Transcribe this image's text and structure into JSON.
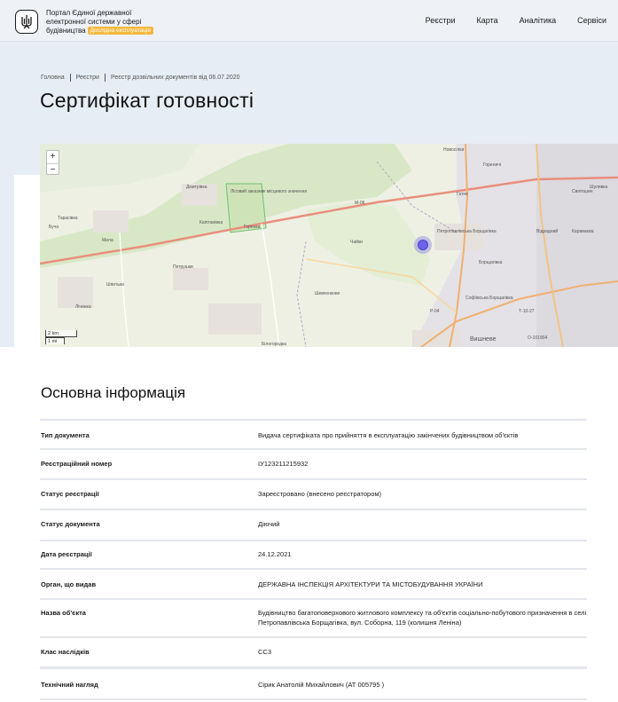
{
  "header": {
    "portal_title_lines": [
      "Портал Єдиної державної",
      "електронної системи у сфері",
      "будівництва"
    ],
    "badge": "Дослідна експлуатація",
    "nav": [
      "Реєстри",
      "Карта",
      "Аналітика",
      "Сервіси"
    ]
  },
  "breadcrumb": [
    "Головна",
    "Реєстри",
    "Реєстр дозвільних документів від 06.07.2020"
  ],
  "page_title": "Сертифікат готовності",
  "map": {
    "zoom_in": "+",
    "zoom_out": "−",
    "scale_km": "2 km",
    "scale_mi": "1 mi",
    "labels": [
      "Новосілки",
      "Гатне",
      "Петропавлівська Борщагівка",
      "Борщагівка",
      "Софіївська Борщагівка",
      "Вишневе",
      "Святошин",
      "Відрадний",
      "Караваєва",
      "Шулявка",
      "Тарасівка",
      "Мила",
      "Буча",
      "Дмитрівка",
      "Капітанівка",
      "Горенка",
      "Петрушки",
      "Шпитьки",
      "Лічинка",
      "Чайки",
      "Шевченкове",
      "Білогородка",
      "Гореничі",
      "Лісовий заказник місцевого значення",
      "М-06",
      "Р-04",
      "Т-10-27",
      "О-101904"
    ]
  },
  "section_title": "Основна інформація",
  "info_rows": [
    {
      "key": "Тип документа",
      "value": "Видача сертифіката про прийняття в експлуатацію закінчених будівництвом об'єктів"
    },
    {
      "key": "Реєстраційний номер",
      "value": "ІУ123211215932"
    },
    {
      "key": "Статус реєстрації",
      "value": "Зареєстровано (внесено реєстратором)"
    },
    {
      "key": "Статус документа",
      "value": "Діючий"
    },
    {
      "key": "Дата реєстрації",
      "value": "24.12.2021"
    },
    {
      "key": "Орган, що видав",
      "value": "ДЕРЖАВНА ІНСПЕКЦІЯ АРХІТЕКТУРИ ТА МІСТОБУДУВАННЯ УКРАЇНИ"
    },
    {
      "key": "Назва об'єкта",
      "value": "Будівництво багатоповерхового житлового комплексу та об'єктів соціально-побутового призначення в селі Петропавлівська Борщагівка, вул. Соборна, 119 (колишня Леніна)"
    },
    {
      "key": "Клас наслідків",
      "value": "СС3"
    },
    {
      "key": "Технічний нагляд",
      "value": "Сірик Анатолій Михайлович (АТ 005795 )"
    }
  ],
  "colors": {
    "accent_badge": "#f5b83d",
    "marker": "#6c63e8",
    "hero_bg": "#e7edf4"
  }
}
